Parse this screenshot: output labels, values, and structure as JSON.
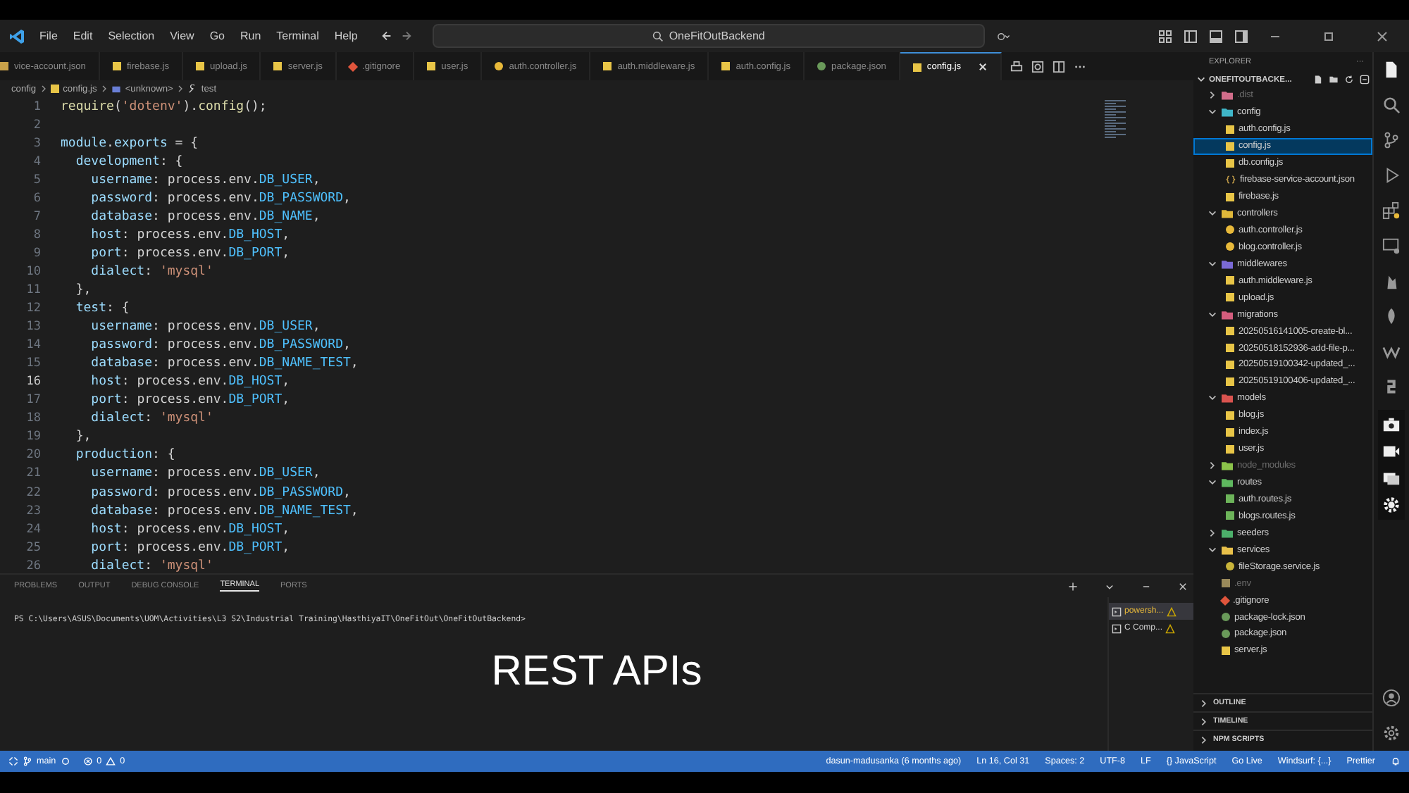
{
  "menu": [
    "File",
    "Edit",
    "Selection",
    "View",
    "Go",
    "Run",
    "Terminal",
    "Help"
  ],
  "search": {
    "value": "OneFitOutBackend"
  },
  "tabs": [
    {
      "label": "vice-account.json",
      "kind": "json",
      "selected": false
    },
    {
      "label": "firebase.js",
      "kind": "js",
      "selected": false
    },
    {
      "label": "upload.js",
      "kind": "js",
      "selected": false
    },
    {
      "label": "server.js",
      "kind": "js",
      "selected": false
    },
    {
      "label": ".gitignore",
      "kind": "git",
      "selected": false
    },
    {
      "label": "user.js",
      "kind": "js",
      "selected": false
    },
    {
      "label": "auth.controller.js",
      "kind": "gear",
      "selected": false
    },
    {
      "label": "auth.middleware.js",
      "kind": "js",
      "selected": false
    },
    {
      "label": "auth.config.js",
      "kind": "js",
      "selected": false
    },
    {
      "label": "package.json",
      "kind": "npm",
      "selected": false
    },
    {
      "label": "config.js",
      "kind": "js",
      "selected": true
    }
  ],
  "breadcrumbs": [
    {
      "label": "config",
      "kind": "folder"
    },
    {
      "label": "config.js",
      "kind": "js"
    },
    {
      "label": "<unknown>",
      "kind": "module"
    },
    {
      "label": "test",
      "kind": "wrench"
    }
  ],
  "code": [
    {
      "n": "1",
      "current": false,
      "t": [
        {
          "kind": "fn",
          "text": "require"
        },
        {
          "kind": "p",
          "text": "("
        },
        {
          "kind": "str",
          "text": "'dotenv'"
        },
        {
          "kind": "p",
          "text": ")."
        },
        {
          "kind": "fn",
          "text": "config"
        },
        {
          "kind": "p",
          "text": "();"
        }
      ]
    },
    {
      "n": "2",
      "current": false
    },
    {
      "n": "3",
      "current": false,
      "t": [
        {
          "kind": "var",
          "text": "module"
        },
        {
          "kind": "p",
          "text": "."
        },
        {
          "kind": "var",
          "text": "exports"
        },
        {
          "kind": "p",
          "text": " = {"
        }
      ]
    },
    {
      "n": "4",
      "current": false,
      "t": [
        {
          "kind": "var",
          "text": "  development"
        },
        {
          "kind": "p",
          "text": ": {"
        }
      ]
    },
    {
      "n": "5",
      "current": false,
      "t": [
        {
          "kind": "var",
          "text": "    username"
        },
        {
          "kind": "p",
          "text": ": process.env."
        },
        {
          "kind": "const",
          "text": "DB_USER"
        },
        {
          "kind": "p",
          "text": ","
        }
      ]
    },
    {
      "n": "6",
      "current": false,
      "t": [
        {
          "kind": "var",
          "text": "    password"
        },
        {
          "kind": "p",
          "text": ": process.env."
        },
        {
          "kind": "const",
          "text": "DB_PASSWORD"
        },
        {
          "kind": "p",
          "text": ","
        }
      ]
    },
    {
      "n": "7",
      "current": false,
      "t": [
        {
          "kind": "var",
          "text": "    database"
        },
        {
          "kind": "p",
          "text": ": process.env."
        },
        {
          "kind": "const",
          "text": "DB_NAME"
        },
        {
          "kind": "p",
          "text": ","
        }
      ]
    },
    {
      "n": "8",
      "current": false,
      "t": [
        {
          "kind": "var",
          "text": "    host"
        },
        {
          "kind": "p",
          "text": ": process.env."
        },
        {
          "kind": "const",
          "text": "DB_HOST"
        },
        {
          "kind": "p",
          "text": ","
        }
      ]
    },
    {
      "n": "9",
      "current": false,
      "t": [
        {
          "kind": "var",
          "text": "    port"
        },
        {
          "kind": "p",
          "text": ": process.env."
        },
        {
          "kind": "const",
          "text": "DB_PORT"
        },
        {
          "kind": "p",
          "text": ","
        }
      ]
    },
    {
      "n": "10",
      "current": false,
      "t": [
        {
          "kind": "var",
          "text": "    dialect"
        },
        {
          "kind": "p",
          "text": ": "
        },
        {
          "kind": "str",
          "text": "'mysql'"
        }
      ]
    },
    {
      "n": "11",
      "current": false,
      "t": [
        {
          "kind": "p",
          "text": "  },"
        }
      ]
    },
    {
      "n": "12",
      "current": false,
      "t": [
        {
          "kind": "var",
          "text": "  test"
        },
        {
          "kind": "p",
          "text": ": {"
        }
      ]
    },
    {
      "n": "13",
      "current": false,
      "t": [
        {
          "kind": "var",
          "text": "    username"
        },
        {
          "kind": "p",
          "text": ": process.env."
        },
        {
          "kind": "const",
          "text": "DB_USER"
        },
        {
          "kind": "p",
          "text": ","
        }
      ]
    },
    {
      "n": "14",
      "current": false,
      "t": [
        {
          "kind": "var",
          "text": "    password"
        },
        {
          "kind": "p",
          "text": ": process.env."
        },
        {
          "kind": "const",
          "text": "DB_PASSWORD"
        },
        {
          "kind": "p",
          "text": ","
        }
      ]
    },
    {
      "n": "15",
      "current": false,
      "t": [
        {
          "kind": "var",
          "text": "    database"
        },
        {
          "kind": "p",
          "text": ": process.env."
        },
        {
          "kind": "const",
          "text": "DB_NAME_TEST"
        },
        {
          "kind": "p",
          "text": ","
        }
      ]
    },
    {
      "n": "16",
      "current": true,
      "t": [
        {
          "kind": "var",
          "text": "    host"
        },
        {
          "kind": "p",
          "text": ": process.env."
        },
        {
          "kind": "const",
          "text": "DB_HOST"
        },
        {
          "kind": "p",
          "text": ","
        }
      ]
    },
    {
      "n": "17",
      "current": false,
      "t": [
        {
          "kind": "var",
          "text": "    port"
        },
        {
          "kind": "p",
          "text": ": process.env."
        },
        {
          "kind": "const",
          "text": "DB_PORT"
        },
        {
          "kind": "p",
          "text": ","
        }
      ]
    },
    {
      "n": "18",
      "current": false,
      "t": [
        {
          "kind": "var",
          "text": "    dialect"
        },
        {
          "kind": "p",
          "text": ": "
        },
        {
          "kind": "str",
          "text": "'mysql'"
        }
      ]
    },
    {
      "n": "19",
      "current": false,
      "t": [
        {
          "kind": "p",
          "text": "  },"
        }
      ]
    },
    {
      "n": "20",
      "current": false,
      "t": [
        {
          "kind": "var",
          "text": "  production"
        },
        {
          "kind": "p",
          "text": ": {"
        }
      ]
    },
    {
      "n": "21",
      "current": false,
      "t": [
        {
          "kind": "var",
          "text": "    username"
        },
        {
          "kind": "p",
          "text": ": process.env."
        },
        {
          "kind": "const",
          "text": "DB_USER"
        },
        {
          "kind": "p",
          "text": ","
        }
      ]
    },
    {
      "n": "22",
      "current": false,
      "t": [
        {
          "kind": "var",
          "text": "    password"
        },
        {
          "kind": "p",
          "text": ": process.env."
        },
        {
          "kind": "const",
          "text": "DB_PASSWORD"
        },
        {
          "kind": "p",
          "text": ","
        }
      ]
    },
    {
      "n": "23",
      "current": false,
      "t": [
        {
          "kind": "var",
          "text": "    database"
        },
        {
          "kind": "p",
          "text": ": process.env."
        },
        {
          "kind": "const",
          "text": "DB_NAME_TEST"
        },
        {
          "kind": "p",
          "text": ","
        }
      ]
    },
    {
      "n": "24",
      "current": false,
      "t": [
        {
          "kind": "var",
          "text": "    host"
        },
        {
          "kind": "p",
          "text": ": process.env."
        },
        {
          "kind": "const",
          "text": "DB_HOST"
        },
        {
          "kind": "p",
          "text": ","
        }
      ]
    },
    {
      "n": "25",
      "current": false,
      "t": [
        {
          "kind": "var",
          "text": "    port"
        },
        {
          "kind": "p",
          "text": ": process.env."
        },
        {
          "kind": "const",
          "text": "DB_PORT"
        },
        {
          "kind": "p",
          "text": ","
        }
      ]
    },
    {
      "n": "26",
      "current": false,
      "t": [
        {
          "kind": "var",
          "text": "    dialect"
        },
        {
          "kind": "p",
          "text": ": "
        },
        {
          "kind": "str",
          "text": "'mysql'"
        }
      ]
    }
  ],
  "panel": {
    "tabs": [
      {
        "label": "PROBLEMS",
        "selected": false
      },
      {
        "label": "OUTPUT",
        "selected": false
      },
      {
        "label": "DEBUG CONSOLE",
        "selected": false
      },
      {
        "label": "TERMINAL",
        "selected": true
      },
      {
        "label": "PORTS",
        "selected": false
      }
    ],
    "prompt": "PS C:\\Users\\ASUS\\Documents\\UOM\\Activities\\L3 S2\\Industrial Training\\HasthiyaIT\\OneFitOut\\OneFitOutBackend>",
    "terminals": [
      {
        "label": "powersh...",
        "selected": true
      },
      {
        "label": "C Comp...",
        "selected": false
      }
    ]
  },
  "caption": "REST APIs",
  "explorer": {
    "title": "EXPLORER",
    "more": "···",
    "root": "ONEFITOUTBACKE...",
    "items": [
      {
        "label": ".dist",
        "kind": "folder",
        "color": "#d16d8a",
        "expanded": false,
        "ignored": true,
        "selected": false
      },
      {
        "label": "config",
        "kind": "folder",
        "color": "#3fb6c8",
        "expanded": true,
        "ignored": false,
        "selected": false,
        "children": [
          {
            "label": "auth.config.js",
            "kind": "js",
            "ignored": false,
            "selected": false
          },
          {
            "label": "config.js",
            "kind": "js",
            "ignored": false,
            "selected": true
          },
          {
            "label": "db.config.js",
            "kind": "js",
            "ignored": false,
            "selected": false
          },
          {
            "label": "firebase-service-account.json",
            "kind": "json",
            "ignored": false,
            "selected": false
          },
          {
            "label": "firebase.js",
            "kind": "js",
            "ignored": false,
            "selected": false
          }
        ]
      },
      {
        "label": "controllers",
        "kind": "folder",
        "color": "#e0b83a",
        "expanded": true,
        "ignored": false,
        "selected": false,
        "children": [
          {
            "label": "auth.controller.js",
            "kind": "gear",
            "ignored": false,
            "selected": false
          },
          {
            "label": "blog.controller.js",
            "kind": "gear",
            "ignored": false,
            "selected": false
          }
        ]
      },
      {
        "label": "middlewares",
        "kind": "folder",
        "color": "#7a6ad6",
        "expanded": true,
        "ignored": false,
        "selected": false,
        "children": [
          {
            "label": "auth.middleware.js",
            "kind": "js",
            "ignored": false,
            "selected": false
          },
          {
            "label": "upload.js",
            "kind": "js",
            "ignored": false,
            "selected": false
          }
        ]
      },
      {
        "label": "migrations",
        "kind": "folder",
        "color": "#d45d7d",
        "expanded": true,
        "ignored": false,
        "selected": false,
        "children": [
          {
            "label": "20250516141005-create-bl...",
            "kind": "js",
            "ignored": false,
            "selected": false
          },
          {
            "label": "20250518152936-add-file-p...",
            "kind": "js",
            "ignored": false,
            "selected": false
          },
          {
            "label": "20250519100342-updated_...",
            "kind": "js",
            "ignored": false,
            "selected": false
          },
          {
            "label": "20250519100406-updated_...",
            "kind": "js",
            "ignored": false,
            "selected": false
          }
        ]
      },
      {
        "label": "models",
        "kind": "folder",
        "color": "#d9534f",
        "expanded": true,
        "ignored": false,
        "selected": false,
        "children": [
          {
            "label": "blog.js",
            "kind": "js",
            "ignored": false,
            "selected": false
          },
          {
            "label": "index.js",
            "kind": "js",
            "ignored": false,
            "selected": false
          },
          {
            "label": "user.js",
            "kind": "js",
            "ignored": false,
            "selected": false
          }
        ]
      },
      {
        "label": "node_modules",
        "kind": "folder",
        "color": "#8bc34a",
        "expanded": false,
        "ignored": true,
        "selected": false
      },
      {
        "label": "routes",
        "kind": "folder",
        "color": "#5fb85f",
        "expanded": true,
        "ignored": false,
        "selected": false,
        "children": [
          {
            "label": "auth.routes.js",
            "kind": "route",
            "ignored": false,
            "selected": false
          },
          {
            "label": "blogs.routes.js",
            "kind": "route",
            "ignored": false,
            "selected": false
          }
        ]
      },
      {
        "label": "seeders",
        "kind": "folder",
        "color": "#4caf6a",
        "expanded": false,
        "ignored": false,
        "selected": false
      },
      {
        "label": "services",
        "kind": "folder",
        "color": "#e8c04a",
        "expanded": true,
        "ignored": false,
        "selected": false,
        "children": [
          {
            "label": "fileStorage.service.js",
            "kind": "service",
            "ignored": false,
            "selected": false
          }
        ]
      },
      {
        "label": ".env",
        "kind": "env",
        "ignored": true,
        "selected": false
      },
      {
        "label": ".gitignore",
        "kind": "git",
        "ignored": false,
        "selected": false
      },
      {
        "label": "package-lock.json",
        "kind": "npm",
        "ignored": false,
        "selected": false
      },
      {
        "label": "package.json",
        "kind": "npm",
        "ignored": false,
        "selected": false
      },
      {
        "label": "server.js",
        "kind": "js",
        "ignored": false,
        "selected": false
      }
    ],
    "sections": [
      "OUTLINE",
      "TIMELINE",
      "NPM SCRIPTS"
    ]
  },
  "status": {
    "branch": "main",
    "errors": "0",
    "warnings": "0",
    "right": [
      "dasun-madusanka (6 months ago)",
      "Ln 16, Col 31",
      "Spaces: 2",
      "UTF-8",
      "LF",
      "{} JavaScript",
      "Go Live",
      "Windsurf: {...}",
      "Prettier"
    ]
  }
}
